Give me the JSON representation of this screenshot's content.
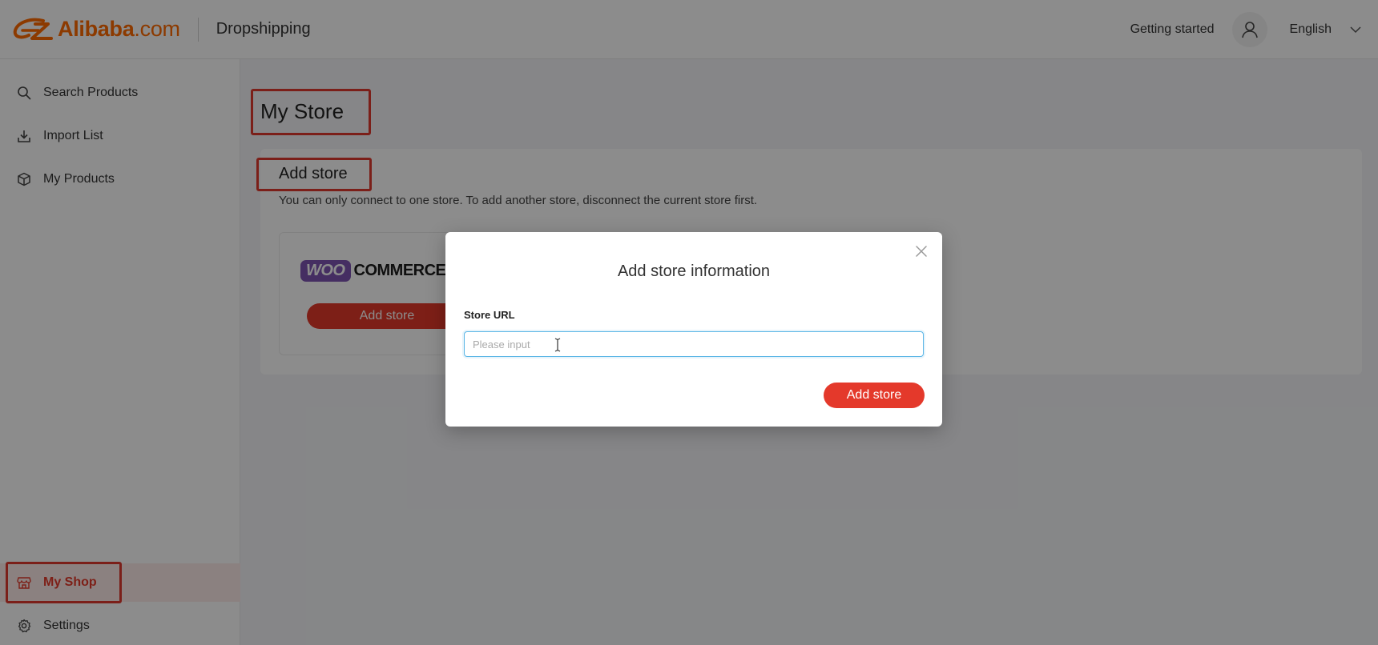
{
  "brand": {
    "name": "Alibaba",
    "suffix": ".com",
    "product": "Dropshipping",
    "accent": "#ff6a00"
  },
  "header": {
    "getting_started": "Getting started",
    "language": "English",
    "user_icon": "user-icon",
    "dropdown_icon": "chevron-down-icon"
  },
  "sidebar": {
    "items": [
      {
        "label": "Search Products",
        "icon": "search-icon"
      },
      {
        "label": "Import List",
        "icon": "download-icon"
      },
      {
        "label": "My Products",
        "icon": "box-icon"
      }
    ],
    "bottom_items": [
      {
        "label": "My Shop",
        "icon": "store-icon",
        "active": true
      },
      {
        "label": "Settings",
        "icon": "gear-icon"
      }
    ]
  },
  "main": {
    "title": "My Store",
    "card": {
      "title": "Add store",
      "description": "You can only connect to one store. To add another store, disconnect the current store first.",
      "store_option": {
        "logo_badge": "WOO",
        "logo_text": "COMMERCE",
        "button": "Add store"
      }
    }
  },
  "modal": {
    "title": "Add store information",
    "field_label": "Store URL",
    "placeholder": "Please input",
    "value": "",
    "submit": "Add store",
    "close_icon": "close-icon"
  },
  "colors": {
    "primary": "#e4392b",
    "highlight": "#e03a2f",
    "woo": "#7f54b3"
  }
}
